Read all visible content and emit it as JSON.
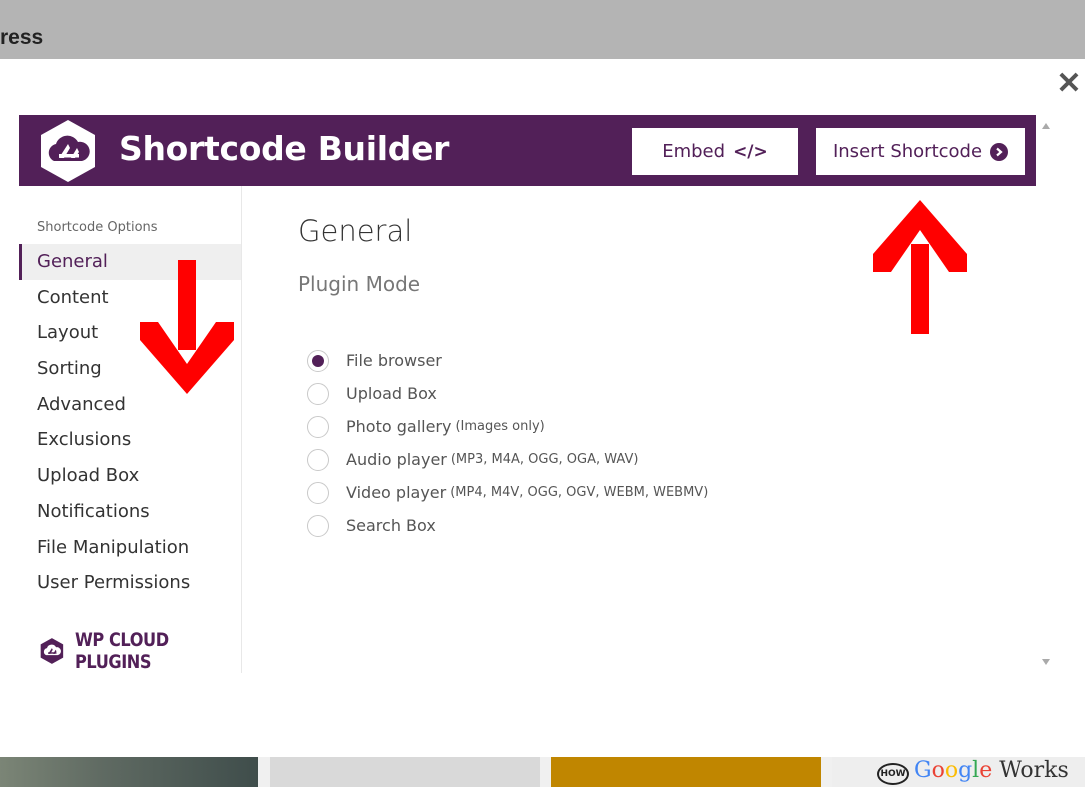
{
  "page": {
    "title_fragment": "ress"
  },
  "modal": {
    "title": "Shortcode Builder",
    "embed_label": "Embed",
    "embed_icon": "code-icon",
    "insert_label": "Insert Shortcode",
    "insert_icon": "arrow-circle-right-icon",
    "close_glyph": "✕"
  },
  "sidebar": {
    "heading": "Shortcode Options",
    "items": [
      {
        "label": "General",
        "active": true
      },
      {
        "label": "Content"
      },
      {
        "label": "Layout"
      },
      {
        "label": "Sorting"
      },
      {
        "label": "Advanced"
      },
      {
        "label": "Exclusions"
      },
      {
        "label": "Upload Box"
      },
      {
        "label": "Notifications"
      },
      {
        "label": "File Manipulation"
      },
      {
        "label": "User Permissions"
      }
    ],
    "brand": "WP CLOUD PLUGINS"
  },
  "main": {
    "section_title": "General",
    "subsection_title": "Plugin Mode",
    "options": [
      {
        "label": "File browser",
        "note": "",
        "selected": true
      },
      {
        "label": "Upload Box",
        "note": ""
      },
      {
        "label": "Photo gallery",
        "note": "(Images only)"
      },
      {
        "label": "Audio player",
        "note": "(MP3, M4A, OGG, OGA, WAV)"
      },
      {
        "label": "Video player",
        "note": "(MP4, M4V, OGG, OGV, WEBM, WEBMV)"
      },
      {
        "label": "Search Box",
        "note": ""
      }
    ]
  },
  "background_strip": {
    "badge": "HOW",
    "google_word": [
      "G",
      "o",
      "o",
      "g",
      "l",
      "e"
    ],
    "google_colors": [
      "#4285F4",
      "#EA4335",
      "#FBBC05",
      "#4285F4",
      "#34A853",
      "#EA4335"
    ],
    "works_word": " Works"
  },
  "colors": {
    "brand_purple": "#522058",
    "annotation_red": "#ff0000"
  }
}
